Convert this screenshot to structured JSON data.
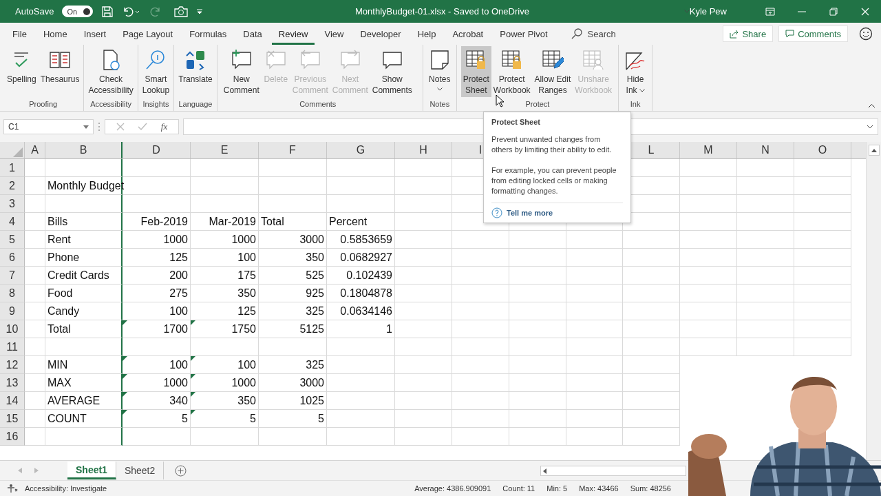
{
  "title_bar": {
    "autosave_label": "AutoSave",
    "autosave": {
      "on": true,
      "label": "On"
    },
    "title": "MonthlyBudget-01.xlsx  -  Saved to OneDrive",
    "user": "Kyle Pew"
  },
  "ribbon_tabs": [
    {
      "label": "File",
      "selected": false
    },
    {
      "label": "Home",
      "selected": false
    },
    {
      "label": "Insert",
      "selected": false
    },
    {
      "label": "Page Layout",
      "selected": false
    },
    {
      "label": "Formulas",
      "selected": false
    },
    {
      "label": "Data",
      "selected": false
    },
    {
      "label": "Review",
      "selected": true
    },
    {
      "label": "View",
      "selected": false
    },
    {
      "label": "Developer",
      "selected": false
    },
    {
      "label": "Help",
      "selected": false
    },
    {
      "label": "Acrobat",
      "selected": false
    },
    {
      "label": "Power Pivot",
      "selected": false
    }
  ],
  "search": {
    "placeholder": "Search"
  },
  "share_button": "Share",
  "comments_button": "Comments",
  "ribbon_groups": [
    {
      "name": "Proofing",
      "buttons": [
        {
          "lines": [
            "Spelling"
          ],
          "disabled": false,
          "highlighted": false,
          "dropdown": false
        },
        {
          "lines": [
            "Thesaurus"
          ],
          "disabled": false,
          "highlighted": false,
          "dropdown": false
        }
      ]
    },
    {
      "name": "Accessibility",
      "buttons": [
        {
          "lines": [
            "Check",
            "Accessibility"
          ],
          "disabled": false,
          "highlighted": false,
          "dropdown": false
        }
      ]
    },
    {
      "name": "Insights",
      "buttons": [
        {
          "lines": [
            "Smart",
            "Lookup"
          ],
          "disabled": false,
          "highlighted": false,
          "dropdown": false
        }
      ]
    },
    {
      "name": "Language",
      "buttons": [
        {
          "lines": [
            "Translate"
          ],
          "disabled": false,
          "highlighted": false,
          "dropdown": false
        }
      ]
    },
    {
      "name": "Comments",
      "buttons": [
        {
          "lines": [
            "New",
            "Comment"
          ],
          "disabled": false,
          "highlighted": false,
          "dropdown": false
        },
        {
          "lines": [
            "Delete"
          ],
          "disabled": true,
          "highlighted": false,
          "dropdown": false
        },
        {
          "lines": [
            "Previous",
            "Comment"
          ],
          "disabled": true,
          "highlighted": false,
          "dropdown": false
        },
        {
          "lines": [
            "Next",
            "Comment"
          ],
          "disabled": true,
          "highlighted": false,
          "dropdown": false
        },
        {
          "lines": [
            "Show",
            "Comments"
          ],
          "disabled": false,
          "highlighted": false,
          "dropdown": false
        }
      ]
    },
    {
      "name": "Notes",
      "buttons": [
        {
          "lines": [
            "Notes"
          ],
          "disabled": false,
          "highlighted": false,
          "dropdown": true
        }
      ]
    },
    {
      "name": "Protect",
      "buttons": [
        {
          "lines": [
            "Protect",
            "Sheet"
          ],
          "disabled": false,
          "highlighted": true,
          "dropdown": false
        },
        {
          "lines": [
            "Protect",
            "Workbook"
          ],
          "disabled": false,
          "highlighted": false,
          "dropdown": false
        },
        {
          "lines": [
            "Allow Edit",
            "Ranges"
          ],
          "disabled": false,
          "highlighted": false,
          "dropdown": false
        },
        {
          "lines": [
            "Unshare",
            "Workbook"
          ],
          "disabled": true,
          "highlighted": false,
          "dropdown": false
        }
      ]
    },
    {
      "name": "Ink",
      "buttons": [
        {
          "lines": [
            "Hide",
            "Ink"
          ],
          "disabled": false,
          "highlighted": false,
          "dropdown": true
        }
      ]
    }
  ],
  "formula_bar": {
    "name_box": "C1",
    "function_label": "fx"
  },
  "column_headers": [
    "A",
    "B",
    "D",
    "E",
    "F",
    "G",
    "H",
    "I",
    "L",
    "M",
    "N",
    "O"
  ],
  "rows": [
    {
      "number": "1",
      "cells": []
    },
    {
      "number": "2",
      "cells": [
        null,
        {
          "text": "Monthly Budget",
          "kind": "text",
          "flagged": false
        }
      ]
    },
    {
      "number": "3",
      "cells": []
    },
    {
      "number": "4",
      "cells": [
        null,
        {
          "text": "Bills",
          "kind": "text",
          "flagged": false
        },
        {
          "text": "Feb-2019",
          "kind": "date",
          "flagged": false
        },
        {
          "text": "Mar-2019",
          "kind": "date",
          "flagged": false
        },
        {
          "text": "Total",
          "kind": "text",
          "flagged": false
        },
        {
          "text": "Percent",
          "kind": "text",
          "flagged": false
        }
      ]
    },
    {
      "number": "5",
      "cells": [
        null,
        {
          "text": "Rent",
          "kind": "text",
          "flagged": false
        },
        {
          "text": "1000",
          "kind": "number",
          "flagged": false
        },
        {
          "text": "1000",
          "kind": "number",
          "flagged": false
        },
        {
          "text": "3000",
          "kind": "number",
          "flagged": false
        },
        {
          "text": "0.5853659",
          "kind": "number",
          "flagged": false
        }
      ]
    },
    {
      "number": "6",
      "cells": [
        null,
        {
          "text": "Phone",
          "kind": "text",
          "flagged": false
        },
        {
          "text": "125",
          "kind": "number",
          "flagged": false
        },
        {
          "text": "100",
          "kind": "number",
          "flagged": false
        },
        {
          "text": "350",
          "kind": "number",
          "flagged": false
        },
        {
          "text": "0.0682927",
          "kind": "number",
          "flagged": false
        }
      ]
    },
    {
      "number": "7",
      "cells": [
        null,
        {
          "text": "Credit Cards",
          "kind": "text",
          "flagged": false
        },
        {
          "text": "200",
          "kind": "number",
          "flagged": false
        },
        {
          "text": "175",
          "kind": "number",
          "flagged": false
        },
        {
          "text": "525",
          "kind": "number",
          "flagged": false
        },
        {
          "text": "0.102439",
          "kind": "number",
          "flagged": false
        }
      ]
    },
    {
      "number": "8",
      "cells": [
        null,
        {
          "text": "Food",
          "kind": "text",
          "flagged": false
        },
        {
          "text": "275",
          "kind": "number",
          "flagged": false
        },
        {
          "text": "350",
          "kind": "number",
          "flagged": false
        },
        {
          "text": "925",
          "kind": "number",
          "flagged": false
        },
        {
          "text": "0.1804878",
          "kind": "number",
          "flagged": false
        }
      ]
    },
    {
      "number": "9",
      "cells": [
        null,
        {
          "text": "Candy",
          "kind": "text",
          "flagged": false
        },
        {
          "text": "100",
          "kind": "number",
          "flagged": false
        },
        {
          "text": "125",
          "kind": "number",
          "flagged": false
        },
        {
          "text": "325",
          "kind": "number",
          "flagged": false
        },
        {
          "text": "0.0634146",
          "kind": "number",
          "flagged": false
        }
      ]
    },
    {
      "number": "10",
      "cells": [
        null,
        {
          "text": "Total",
          "kind": "text",
          "flagged": false
        },
        {
          "text": "1700",
          "kind": "number",
          "flagged": true
        },
        {
          "text": "1750",
          "kind": "number",
          "flagged": true
        },
        {
          "text": "5125",
          "kind": "number",
          "flagged": false
        },
        {
          "text": "1",
          "kind": "number",
          "flagged": false
        }
      ]
    },
    {
      "number": "11",
      "cells": []
    },
    {
      "number": "12",
      "cells": [
        null,
        {
          "text": "MIN",
          "kind": "text",
          "flagged": false
        },
        {
          "text": "100",
          "kind": "number",
          "flagged": true
        },
        {
          "text": "100",
          "kind": "number",
          "flagged": true
        },
        {
          "text": "325",
          "kind": "number",
          "flagged": false
        }
      ]
    },
    {
      "number": "13",
      "cells": [
        null,
        {
          "text": "MAX",
          "kind": "text",
          "flagged": false
        },
        {
          "text": "1000",
          "kind": "number",
          "flagged": true
        },
        {
          "text": "1000",
          "kind": "number",
          "flagged": true
        },
        {
          "text": "3000",
          "kind": "number",
          "flagged": false
        }
      ]
    },
    {
      "number": "14",
      "cells": [
        null,
        {
          "text": "AVERAGE",
          "kind": "text",
          "flagged": false
        },
        {
          "text": "340",
          "kind": "number",
          "flagged": true
        },
        {
          "text": "350",
          "kind": "number",
          "flagged": true
        },
        {
          "text": "1025",
          "kind": "number",
          "flagged": false
        }
      ]
    },
    {
      "number": "15",
      "cells": [
        null,
        {
          "text": "COUNT",
          "kind": "text",
          "flagged": false
        },
        {
          "text": "5",
          "kind": "number",
          "flagged": true
        },
        {
          "text": "5",
          "kind": "number",
          "flagged": true
        },
        {
          "text": "5",
          "kind": "number",
          "flagged": false
        }
      ]
    },
    {
      "number": "16",
      "cells": []
    }
  ],
  "sheet_tabs": [
    {
      "label": "Sheet1",
      "selected": true
    },
    {
      "label": "Sheet2",
      "selected": false
    }
  ],
  "status_bar": {
    "accessibility": "Accessibility: Investigate",
    "stats": [
      "Average: 4386.909091",
      "Count: 11",
      "Min: 5",
      "Max: 43466",
      "Sum: 48256"
    ]
  },
  "tooltip": {
    "title": "Protect Sheet",
    "paragraphs": [
      "Prevent unwanted changes from others by limiting their ability to edit.",
      "For example, you can prevent people from editing locked cells or making formatting changes."
    ],
    "link": "Tell me more"
  }
}
